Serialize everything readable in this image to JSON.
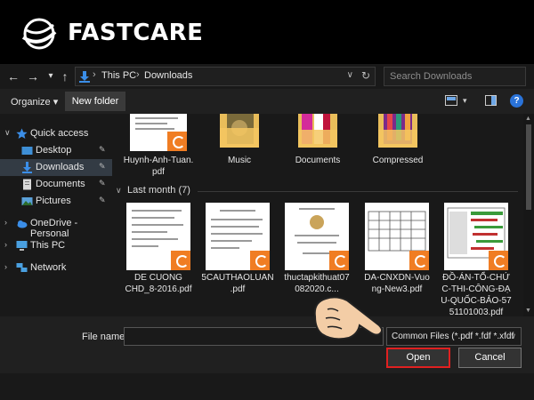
{
  "brand": {
    "name": "FASTCARE"
  },
  "address": {
    "crumbs": [
      "This PC",
      "Downloads"
    ],
    "search_placeholder": "Search Downloads"
  },
  "toolbar": {
    "organize_label": "Organize ▾",
    "new_folder_label": "New folder"
  },
  "sidebar": {
    "items": [
      {
        "label": "Quick access"
      },
      {
        "label": "Desktop"
      },
      {
        "label": "Downloads"
      },
      {
        "label": "Documents"
      },
      {
        "label": "Pictures"
      },
      {
        "label": "OneDrive - Personal"
      },
      {
        "label": "This PC"
      },
      {
        "label": "Network"
      }
    ]
  },
  "content": {
    "top_files": [
      {
        "name_lines": [
          "Huynh-Anh-Tuan.",
          "pdf"
        ]
      },
      {
        "name_lines": [
          "Music"
        ]
      },
      {
        "name_lines": [
          "Documents"
        ]
      },
      {
        "name_lines": [
          "Compressed"
        ]
      }
    ],
    "group_title": "Last month (7)",
    "files": [
      {
        "name_lines": [
          "DE CUONG",
          "CHD_8-2016.pdf"
        ]
      },
      {
        "name_lines": [
          "5CAUTHAOLUAN",
          ".pdf"
        ]
      },
      {
        "name_lines": [
          "thuctapkithuat07",
          "082020.c..."
        ]
      },
      {
        "name_lines": [
          "DA-CNXDN-Vuo",
          "ng-New3.pdf"
        ]
      },
      {
        "name_lines": [
          "ĐỒ-ÁN-TỔ-CHỨ",
          "C-THI-CÔNG-ĐẠ",
          "U-QUỐC-BẢO-57",
          "51101003.pdf"
        ]
      }
    ]
  },
  "footer": {
    "file_name_label": "File name:",
    "file_name_value": "",
    "filter_label": "Common Files (*.pdf *.fdf *.xfdf",
    "open_label": "Open",
    "cancel_label": "Cancel"
  },
  "colors": {
    "accent": "#2a73d9",
    "highlight": "#e02020",
    "badge": "#f07d23",
    "folder": "#f4c762"
  }
}
